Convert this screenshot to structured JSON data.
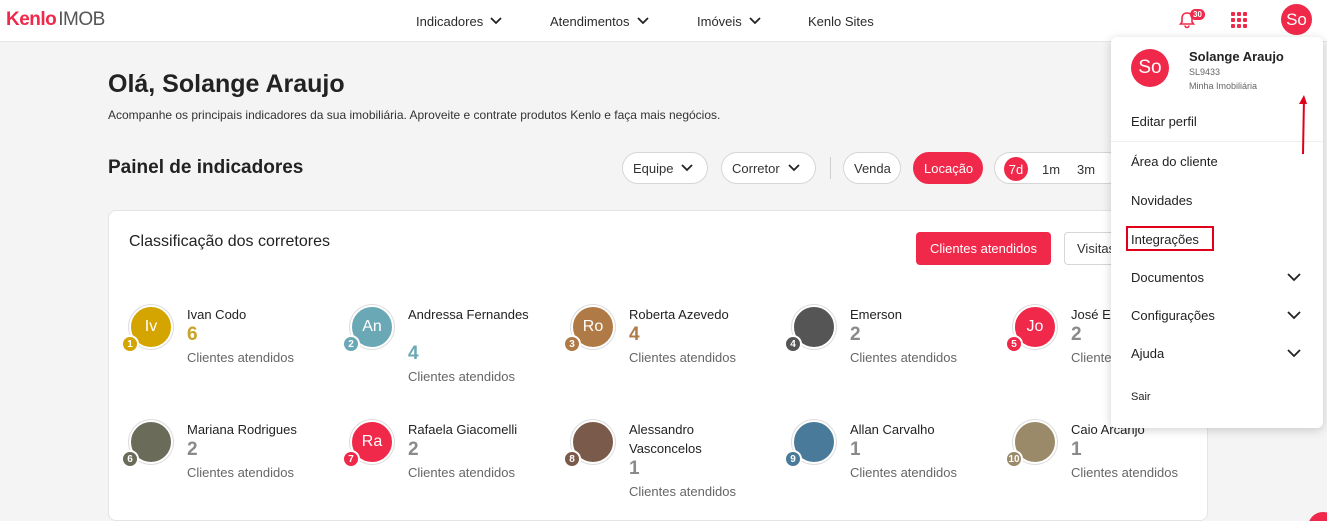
{
  "header": {
    "brand": "Kenlo",
    "product": "IMOB",
    "nav": [
      "Indicadores",
      "Atendimentos",
      "Imóveis",
      "Kenlo Sites"
    ],
    "notifications": "30",
    "avatar_initials": "So"
  },
  "greeting": "Olá, Solange Araujo",
  "subtitle": "Acompanhe os principais indicadores da sua imobiliária. Aproveite e contrate produtos Kenlo e faça mais negócios.",
  "panel": {
    "title": "Painel de indicadores",
    "filters": [
      "Equipe",
      "Corretor"
    ],
    "types": [
      "Venda",
      "Locação"
    ],
    "active_type": "Locação",
    "periods": [
      "7d",
      "1m",
      "3m"
    ],
    "active_period": "7d"
  },
  "ranking": {
    "title": "Classificação dos corretores",
    "tab_active": "Clientes atendidos",
    "tab_other": "Visitas",
    "unit_label": "Clientes atendidos",
    "items": [
      {
        "rank": "1",
        "name": "Ivan Codo",
        "count": "6",
        "initials": "Iv",
        "color": "#d4a400",
        "count_color": "#c9a227"
      },
      {
        "rank": "2",
        "name": "Andressa Fernandes",
        "count": "4",
        "initials": "An",
        "color": "#6aa8b6",
        "count_color": "#6aa8b6"
      },
      {
        "rank": "3",
        "name": "Roberta Azevedo",
        "count": "4",
        "initials": "Ro",
        "color": "#b07a46",
        "count_color": "#b07a46"
      },
      {
        "rank": "4",
        "name": "Emerson",
        "count": "2",
        "initials": "",
        "color": "#555555",
        "count_color": "#8a8a8a"
      },
      {
        "rank": "5",
        "name": "José Ed",
        "count": "2",
        "initials": "Jo",
        "color": "#f0284a",
        "count_color": "#8a8a8a"
      },
      {
        "rank": "6",
        "name": "Mariana Rodrigues",
        "count": "2",
        "initials": "",
        "color": "#6b6b5a",
        "count_color": "#8a8a8a"
      },
      {
        "rank": "7",
        "name": "Rafaela Giacomelli",
        "count": "2",
        "initials": "Ra",
        "color": "#f0284a",
        "count_color": "#8a8a8a"
      },
      {
        "rank": "8",
        "name": "Alessandro Vasconcelos",
        "count": "1",
        "initials": "",
        "color": "#7a5a4a",
        "count_color": "#8a8a8a"
      },
      {
        "rank": "9",
        "name": "Allan Carvalho",
        "count": "1",
        "initials": "",
        "color": "#4a7a9a",
        "count_color": "#8a8a8a"
      },
      {
        "rank": "10",
        "name": "Caio Arcanjo",
        "count": "1",
        "initials": "",
        "color": "#9a8a6a",
        "count_color": "#8a8a8a"
      }
    ]
  },
  "user_menu": {
    "initials": "So",
    "name": "Solange Araujo",
    "code": "SL9433",
    "org": "Minha Imobiliária",
    "items": [
      "Editar perfil",
      "Área do cliente",
      "Novidades",
      "Integrações",
      "Documentos",
      "Configurações",
      "Ajuda",
      "Sair"
    ]
  },
  "colors": {
    "accent": "#f0284a",
    "highlight": "#e0001a"
  }
}
